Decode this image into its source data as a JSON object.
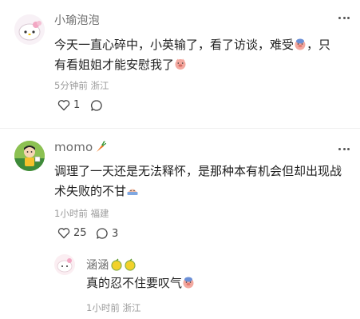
{
  "comments": [
    {
      "username": "小瑜泡泡",
      "text_line1": "今天一直心碎中，小英输了，看了访谈，难受",
      "text_line1_tail": "，只",
      "text_line2": "有看姐姐才能安慰我了",
      "time": "5分钟前",
      "location": "浙江",
      "likes": "1",
      "reply_count": ""
    },
    {
      "username": "momo",
      "text_line1": "调理了一天还是无法释怀，是那种本有机会但却出现战",
      "text_line2": "术失败的不甘",
      "time": "1小时前",
      "location": "福建",
      "likes": "25",
      "reply_count": "3"
    }
  ],
  "reply": {
    "username": "涵涵",
    "text": "真的忍不住要叹气",
    "time": "1小时前",
    "location": "浙江"
  },
  "icons": {
    "like": "heart-icon",
    "comment": "comment-bubble-icon",
    "more": "more-dots-icon"
  },
  "colors": {
    "accent_carrot": "#f07a2a",
    "text_muted": "#9a9a9a"
  }
}
